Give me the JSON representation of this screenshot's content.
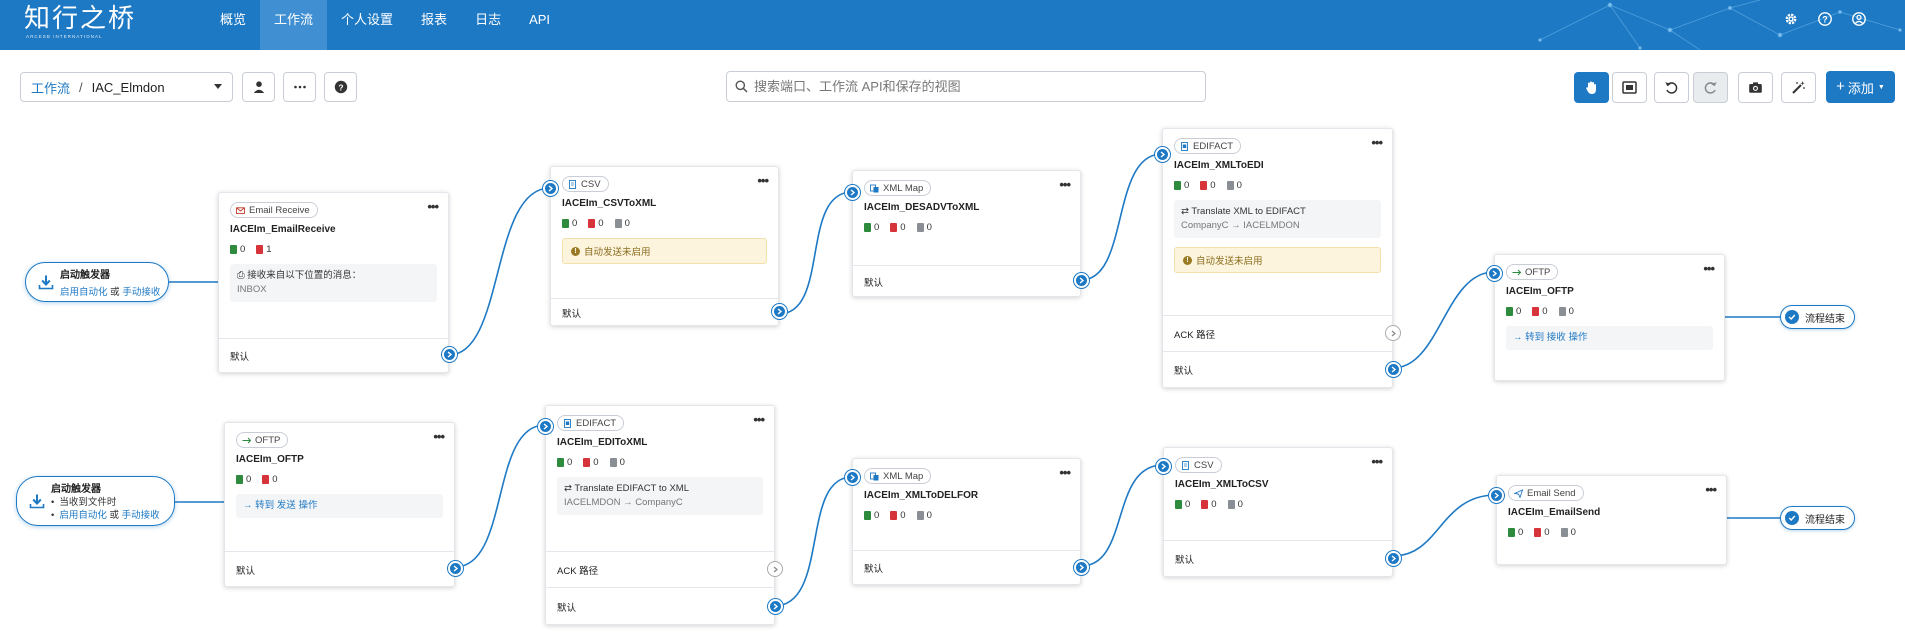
{
  "header": {
    "logo": "知行之桥",
    "logo_sub": "ARCESB INTERNATIONAL",
    "menu": [
      {
        "label": "概览"
      },
      {
        "label": "工作流"
      },
      {
        "label": "个人设置"
      },
      {
        "label": "报表"
      },
      {
        "label": "日志"
      },
      {
        "label": "API"
      }
    ],
    "active_menu": "工作流",
    "icons": [
      "gear-icon",
      "help-icon",
      "user-icon"
    ]
  },
  "toolbar": {
    "breadcrumb_root": "工作流",
    "breadcrumb_sep": "/",
    "breadcrumb_current": "IAC_Elmdon",
    "search_placeholder": "搜索端口、工作流 API和保存的视图",
    "add_label": "添加"
  },
  "colors": {
    "accent": "#1e79c4",
    "warn_bg": "#fdf4dd",
    "success": "#2e8b3e",
    "error": "#d6333a"
  },
  "triggers": [
    {
      "title": "启动触发器",
      "sub_a": "启用自动化",
      "sub_or": "或",
      "sub_b": "手动接收"
    },
    {
      "title": "启动触发器",
      "line1": "当收到文件时",
      "line2_a": "启用自动化",
      "line2_or": "或",
      "line2_b": "手动接收"
    }
  ],
  "flow_end_label": "流程结束",
  "cards": {
    "email_receive": {
      "type": "Email Receive",
      "name": "IACEIm_EmailReceive",
      "counts": [
        "0",
        "1"
      ],
      "info_label": "接收来自以下位置的消息：",
      "info_value": "INBOX",
      "output": "默认"
    },
    "oftp_in": {
      "type": "OFTP",
      "name": "IACEIm_OFTP",
      "counts": [
        "0",
        "0"
      ],
      "link_a": "→ 转到",
      "link_b": "发送",
      "link_c": "操作",
      "output": "默认"
    },
    "csv_to_xml": {
      "type": "CSV",
      "name": "IACEIm_CSVToXML",
      "counts": [
        "0",
        "0",
        "0"
      ],
      "warn": "自动发送未启用",
      "output": "默认"
    },
    "edi_to_xml": {
      "type": "EDIFACT",
      "name": "IACEIm_EDIToXML",
      "counts": [
        "0",
        "0",
        "0"
      ],
      "info_label": "⇄ Translate EDIFACT to XML",
      "info_value": "IACELMDON → CompanyC",
      "ack": "ACK 路径",
      "output": "默认"
    },
    "desadv_to_xml": {
      "type": "XML Map",
      "name": "IACEIm_DESADVToXML",
      "counts": [
        "0",
        "0",
        "0"
      ],
      "output": "默认"
    },
    "xml_to_delfor": {
      "type": "XML Map",
      "name": "IACEIm_XMLToDELFOR",
      "counts": [
        "0",
        "0",
        "0"
      ],
      "output": "默认"
    },
    "xml_to_edi": {
      "type": "EDIFACT",
      "name": "IACEIm_XMLToEDI",
      "counts": [
        "0",
        "0",
        "0"
      ],
      "info_label": "⇄ Translate XML to EDIFACT",
      "info_value": "CompanyC → IACELMDON",
      "warn": "自动发送未启用",
      "ack": "ACK 路径",
      "output": "默认"
    },
    "xml_to_csv": {
      "type": "CSV",
      "name": "IACEIm_XMLToCSV",
      "counts": [
        "0",
        "0",
        "0"
      ],
      "output": "默认"
    },
    "oftp_out": {
      "type": "OFTP",
      "name": "IACEIm_OFTP",
      "counts": [
        "0",
        "0",
        "0"
      ],
      "link_a": "→ 转到",
      "link_b": "接收",
      "link_c": "操作"
    },
    "email_send": {
      "type": "Email Send",
      "name": "IACEIm_EmailSend",
      "counts": [
        "0",
        "0",
        "0"
      ]
    }
  }
}
